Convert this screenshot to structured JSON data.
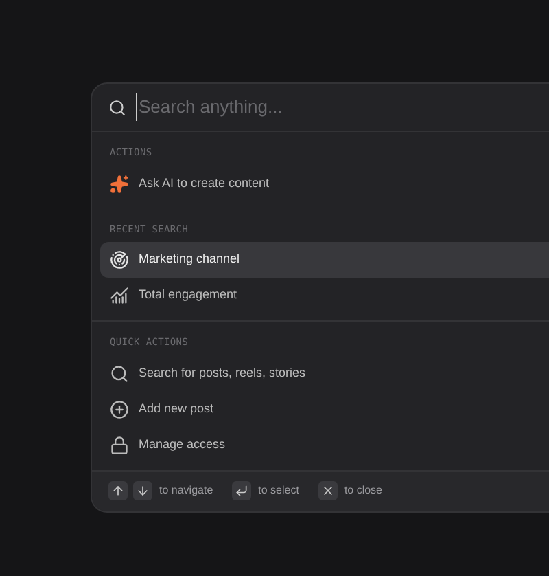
{
  "search": {
    "placeholder": "Search anything..."
  },
  "sections": [
    {
      "title": "ACTIONS",
      "items": [
        {
          "label": "Ask AI to create content",
          "kind": "sparkle",
          "selected": false
        }
      ]
    },
    {
      "title": "RECENT SEARCH",
      "items": [
        {
          "label": "Marketing channel",
          "kind": "target",
          "selected": true
        },
        {
          "label": "Total engagement",
          "kind": "chart",
          "selected": false
        }
      ]
    },
    {
      "title": "QUICK ACTIONS",
      "items": [
        {
          "label": "Search for posts, reels, stories",
          "kind": "search",
          "selected": false
        },
        {
          "label": "Add new post",
          "kind": "plus",
          "selected": false
        },
        {
          "label": "Manage access",
          "kind": "lock",
          "selected": false
        }
      ]
    }
  ],
  "footer": [
    {
      "keys": [
        {
          "kind": "up"
        },
        {
          "kind": "down"
        }
      ],
      "label": "to navigate"
    },
    {
      "keys": [
        {
          "kind": "enter"
        }
      ],
      "label": "to select"
    },
    {
      "keys": [
        {
          "kind": "esc"
        }
      ],
      "label": "to close"
    }
  ]
}
